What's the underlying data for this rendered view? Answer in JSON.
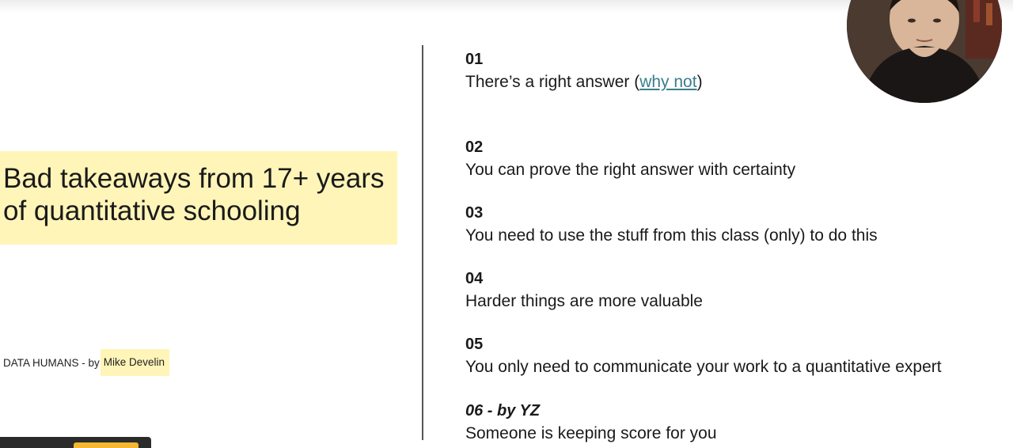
{
  "slide": {
    "title": "Bad takeaways from 17+ years\nof quantitative schooling",
    "credit": {
      "prefix": "DATA HUMANS - by",
      "author": "Mike Develin"
    },
    "items": [
      {
        "num": "01",
        "text_before": "There’s a right answer (",
        "link": "why not",
        "text_after": ")"
      },
      {
        "num": "02",
        "text": "You can prove the right answer with certainty"
      },
      {
        "num": "03",
        "text": "You need to use the stuff from this class (only) to do this"
      },
      {
        "num": "04",
        "text": "Harder things are more valuable"
      },
      {
        "num": "05",
        "text": "You only need to communicate your work to a quantitative expert"
      },
      {
        "num": "06 - by YZ",
        "text": "Someone is keeping score for you"
      }
    ]
  },
  "colors": {
    "highlight": "#fff5b8",
    "link": "#3a7d8c",
    "accent": "#f5b731"
  },
  "icons": {
    "webcam": "person-video-icon"
  }
}
